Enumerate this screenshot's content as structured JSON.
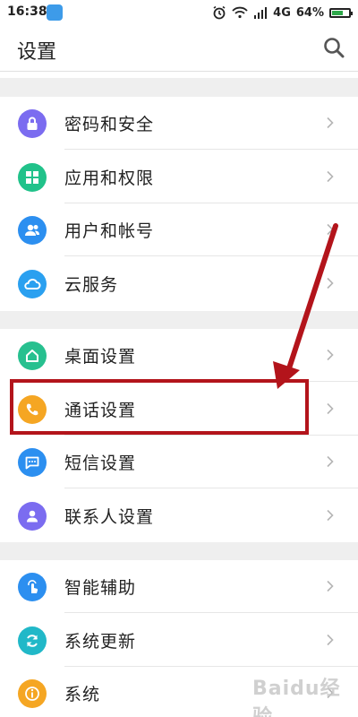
{
  "status_bar": {
    "time": "16:38",
    "network": "4G",
    "battery_percent": "64%",
    "battery_level": 0.64
  },
  "header": {
    "title": "设置"
  },
  "sections": [
    {
      "items": [
        {
          "label": "密码和安全",
          "icon": "lock-icon",
          "color": "#7b6cf0"
        },
        {
          "label": "应用和权限",
          "icon": "apps-grid-icon",
          "color": "#21c28a"
        },
        {
          "label": "用户和帐号",
          "icon": "users-icon",
          "color": "#2c8ff0"
        },
        {
          "label": "云服务",
          "icon": "cloud-icon",
          "color": "#2aa0f0"
        }
      ]
    },
    {
      "items": [
        {
          "label": "桌面设置",
          "icon": "home-icon",
          "color": "#27c08f"
        },
        {
          "label": "通话设置",
          "icon": "phone-icon",
          "color": "#f5a623"
        },
        {
          "label": "短信设置",
          "icon": "message-icon",
          "color": "#2c8ff0"
        },
        {
          "label": "联系人设置",
          "icon": "contact-icon",
          "color": "#7b6cf0"
        }
      ]
    },
    {
      "items": [
        {
          "label": "智能辅助",
          "icon": "touch-icon",
          "color": "#2c8ff0"
        },
        {
          "label": "系统更新",
          "icon": "refresh-icon",
          "color": "#21b8c8"
        },
        {
          "label": "系统",
          "icon": "info-icon",
          "color": "#f5a623"
        }
      ]
    }
  ],
  "annotation": {
    "color": "#b3141b"
  },
  "watermark": {
    "text": "Baidu经验"
  }
}
